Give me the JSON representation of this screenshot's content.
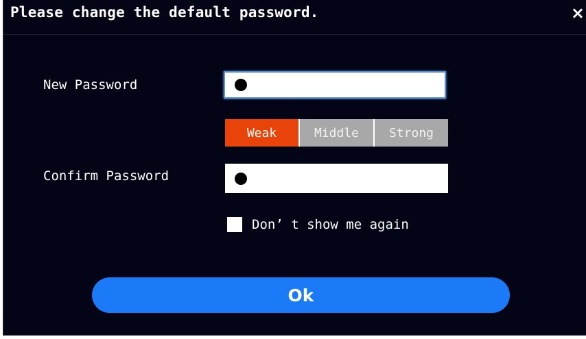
{
  "dialog": {
    "title": "Please change the default password.",
    "close_icon": "×"
  },
  "form": {
    "new_password_label": "New Password",
    "confirm_password_label": "Confirm Password",
    "new_password_value": "●",
    "confirm_password_value": "●"
  },
  "strength": {
    "levels": [
      "Weak",
      "Middle",
      "Strong"
    ],
    "selected": "Weak",
    "active_color": "#e8440a",
    "inactive_color": "#a8a8a8"
  },
  "dont_show": {
    "label": "Don’ t show me again",
    "checked": false
  },
  "ok_button": {
    "label": "Ok",
    "color": "#1a7af8"
  }
}
